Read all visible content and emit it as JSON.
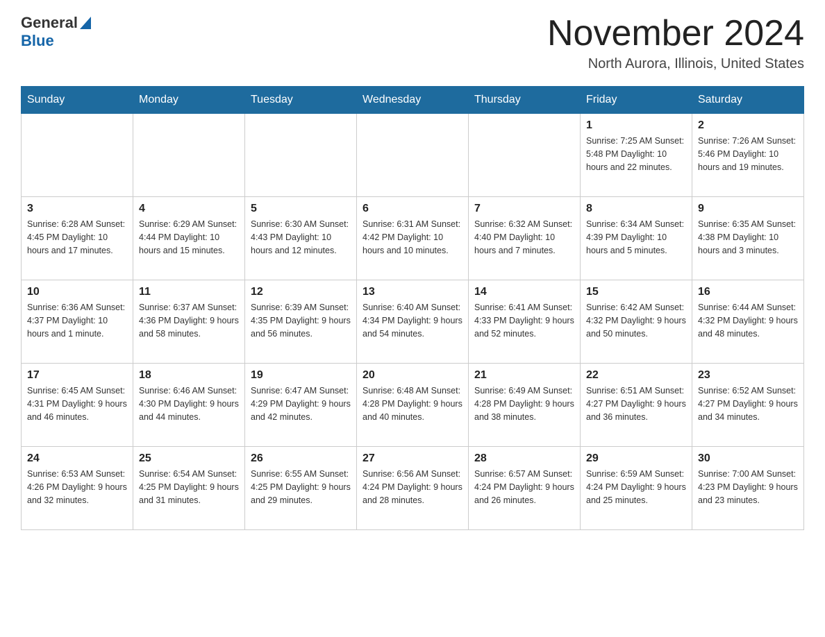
{
  "header": {
    "logo": {
      "general": "General",
      "blue": "Blue"
    },
    "month_title": "November 2024",
    "location": "North Aurora, Illinois, United States"
  },
  "weekdays": [
    "Sunday",
    "Monday",
    "Tuesday",
    "Wednesday",
    "Thursday",
    "Friday",
    "Saturday"
  ],
  "weeks": [
    [
      {
        "day": "",
        "info": ""
      },
      {
        "day": "",
        "info": ""
      },
      {
        "day": "",
        "info": ""
      },
      {
        "day": "",
        "info": ""
      },
      {
        "day": "",
        "info": ""
      },
      {
        "day": "1",
        "info": "Sunrise: 7:25 AM\nSunset: 5:48 PM\nDaylight: 10 hours\nand 22 minutes."
      },
      {
        "day": "2",
        "info": "Sunrise: 7:26 AM\nSunset: 5:46 PM\nDaylight: 10 hours\nand 19 minutes."
      }
    ],
    [
      {
        "day": "3",
        "info": "Sunrise: 6:28 AM\nSunset: 4:45 PM\nDaylight: 10 hours\nand 17 minutes."
      },
      {
        "day": "4",
        "info": "Sunrise: 6:29 AM\nSunset: 4:44 PM\nDaylight: 10 hours\nand 15 minutes."
      },
      {
        "day": "5",
        "info": "Sunrise: 6:30 AM\nSunset: 4:43 PM\nDaylight: 10 hours\nand 12 minutes."
      },
      {
        "day": "6",
        "info": "Sunrise: 6:31 AM\nSunset: 4:42 PM\nDaylight: 10 hours\nand 10 minutes."
      },
      {
        "day": "7",
        "info": "Sunrise: 6:32 AM\nSunset: 4:40 PM\nDaylight: 10 hours\nand 7 minutes."
      },
      {
        "day": "8",
        "info": "Sunrise: 6:34 AM\nSunset: 4:39 PM\nDaylight: 10 hours\nand 5 minutes."
      },
      {
        "day": "9",
        "info": "Sunrise: 6:35 AM\nSunset: 4:38 PM\nDaylight: 10 hours\nand 3 minutes."
      }
    ],
    [
      {
        "day": "10",
        "info": "Sunrise: 6:36 AM\nSunset: 4:37 PM\nDaylight: 10 hours\nand 1 minute."
      },
      {
        "day": "11",
        "info": "Sunrise: 6:37 AM\nSunset: 4:36 PM\nDaylight: 9 hours\nand 58 minutes."
      },
      {
        "day": "12",
        "info": "Sunrise: 6:39 AM\nSunset: 4:35 PM\nDaylight: 9 hours\nand 56 minutes."
      },
      {
        "day": "13",
        "info": "Sunrise: 6:40 AM\nSunset: 4:34 PM\nDaylight: 9 hours\nand 54 minutes."
      },
      {
        "day": "14",
        "info": "Sunrise: 6:41 AM\nSunset: 4:33 PM\nDaylight: 9 hours\nand 52 minutes."
      },
      {
        "day": "15",
        "info": "Sunrise: 6:42 AM\nSunset: 4:32 PM\nDaylight: 9 hours\nand 50 minutes."
      },
      {
        "day": "16",
        "info": "Sunrise: 6:44 AM\nSunset: 4:32 PM\nDaylight: 9 hours\nand 48 minutes."
      }
    ],
    [
      {
        "day": "17",
        "info": "Sunrise: 6:45 AM\nSunset: 4:31 PM\nDaylight: 9 hours\nand 46 minutes."
      },
      {
        "day": "18",
        "info": "Sunrise: 6:46 AM\nSunset: 4:30 PM\nDaylight: 9 hours\nand 44 minutes."
      },
      {
        "day": "19",
        "info": "Sunrise: 6:47 AM\nSunset: 4:29 PM\nDaylight: 9 hours\nand 42 minutes."
      },
      {
        "day": "20",
        "info": "Sunrise: 6:48 AM\nSunset: 4:28 PM\nDaylight: 9 hours\nand 40 minutes."
      },
      {
        "day": "21",
        "info": "Sunrise: 6:49 AM\nSunset: 4:28 PM\nDaylight: 9 hours\nand 38 minutes."
      },
      {
        "day": "22",
        "info": "Sunrise: 6:51 AM\nSunset: 4:27 PM\nDaylight: 9 hours\nand 36 minutes."
      },
      {
        "day": "23",
        "info": "Sunrise: 6:52 AM\nSunset: 4:27 PM\nDaylight: 9 hours\nand 34 minutes."
      }
    ],
    [
      {
        "day": "24",
        "info": "Sunrise: 6:53 AM\nSunset: 4:26 PM\nDaylight: 9 hours\nand 32 minutes."
      },
      {
        "day": "25",
        "info": "Sunrise: 6:54 AM\nSunset: 4:25 PM\nDaylight: 9 hours\nand 31 minutes."
      },
      {
        "day": "26",
        "info": "Sunrise: 6:55 AM\nSunset: 4:25 PM\nDaylight: 9 hours\nand 29 minutes."
      },
      {
        "day": "27",
        "info": "Sunrise: 6:56 AM\nSunset: 4:24 PM\nDaylight: 9 hours\nand 28 minutes."
      },
      {
        "day": "28",
        "info": "Sunrise: 6:57 AM\nSunset: 4:24 PM\nDaylight: 9 hours\nand 26 minutes."
      },
      {
        "day": "29",
        "info": "Sunrise: 6:59 AM\nSunset: 4:24 PM\nDaylight: 9 hours\nand 25 minutes."
      },
      {
        "day": "30",
        "info": "Sunrise: 7:00 AM\nSunset: 4:23 PM\nDaylight: 9 hours\nand 23 minutes."
      }
    ]
  ]
}
